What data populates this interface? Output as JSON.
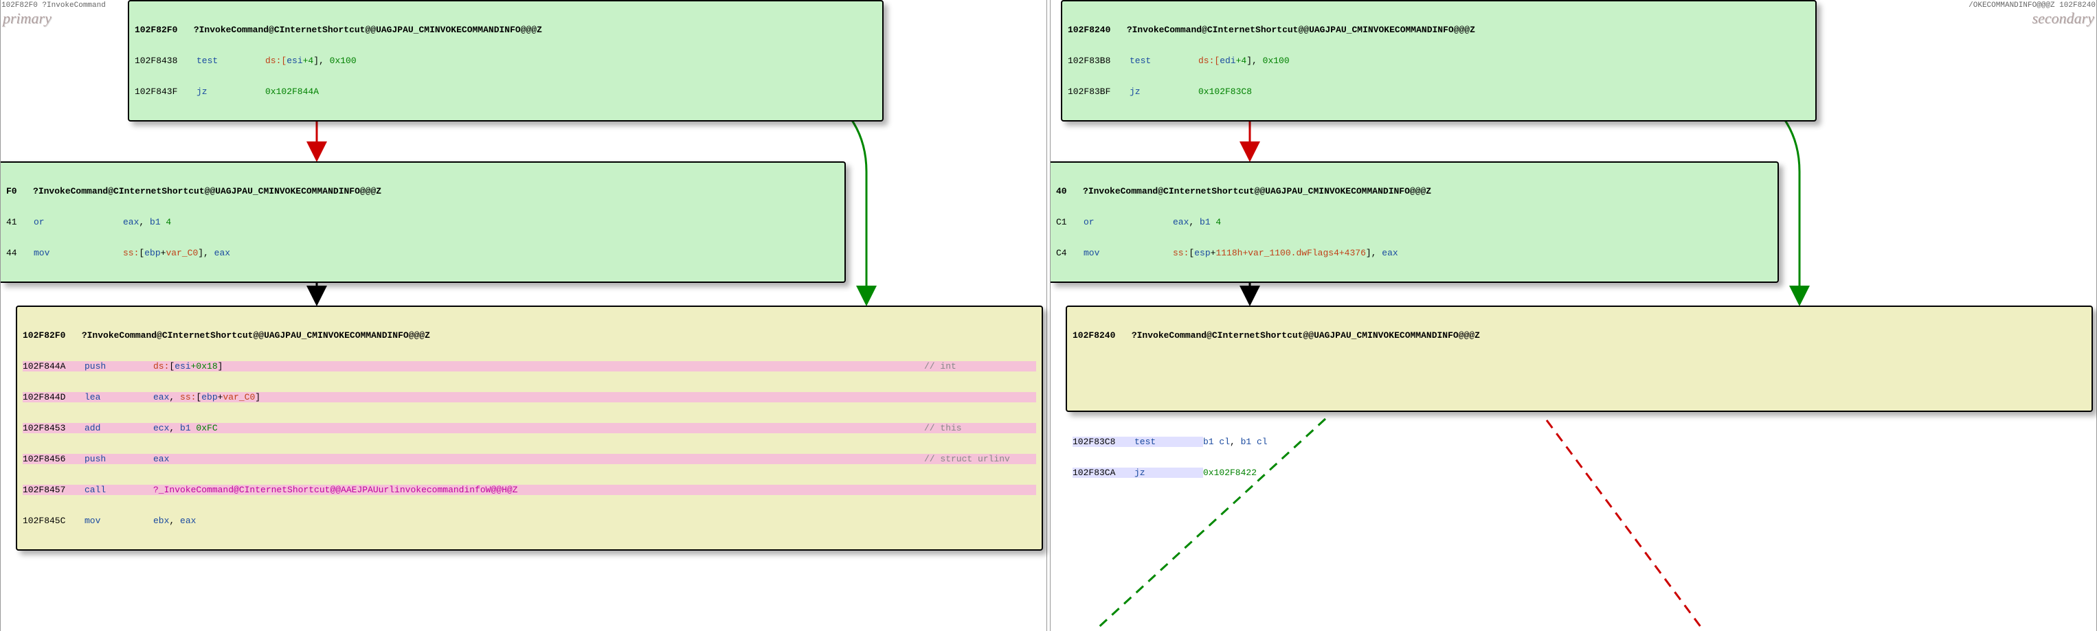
{
  "header": {
    "left_text": "102F82F0  ?InvokeCommand",
    "right_text": "/OKECOMMANDINFO@@@Z  102F8240",
    "primary_label": "primary",
    "secondary_label": "secondary"
  },
  "left": {
    "block1": {
      "addr": "102F82F0",
      "func": "?InvokeCommand@CInternetShortcut@@UAGJPAU_CMINVOKECOMMANDINFO@@@Z",
      "rows": [
        {
          "addr": "102F8438",
          "mnem": "test",
          "ops_pre": "ds:[",
          "ops_reg": "esi",
          "ops_off": "+4",
          "ops_post": "], ",
          "ops_val": "0x100"
        },
        {
          "addr": "102F843F",
          "mnem": "jz",
          "target": "0x102F844A"
        }
      ]
    },
    "block2": {
      "addr": "F0",
      "func": "?InvokeCommand@CInternetShortcut@@UAGJPAU_CMINVOKECOMMANDINFO@@@Z",
      "rows": [
        {
          "addr": "41",
          "mnem": "or",
          "op1": "eax",
          "sep": ", ",
          "b1": "b1 ",
          "val": "4"
        },
        {
          "addr": "44",
          "mnem": "mov",
          "seg": "ss:",
          "br": "[",
          "reg": "ebp",
          "plus": "+",
          "var": "var_C0",
          "cl": "], ",
          "reg2": "eax"
        }
      ]
    },
    "block3": {
      "addr": "102F82F0",
      "func": "?InvokeCommand@CInternetShortcut@@UAGJPAU_CMINVOKECOMMANDINFO@@@Z",
      "rows": [
        {
          "addr": "102F844A",
          "mnem": "push",
          "seg": "ds:",
          "br": "[",
          "reg": "esi",
          "off": "+0x18",
          "cl": "]",
          "comment": "// int"
        },
        {
          "addr": "102F844D",
          "mnem": "lea",
          "op1": "eax",
          "sep": ", ",
          "seg": "ss:",
          "br": "[",
          "reg": "ebp",
          "plus": "+",
          "var": "var_C0",
          "cl": "]"
        },
        {
          "addr": "102F8453",
          "mnem": "add",
          "op1": "ecx",
          "sep": ", ",
          "b1": "b1 ",
          "val": "0xFC",
          "comment": "// this"
        },
        {
          "addr": "102F8456",
          "mnem": "push",
          "op1": "eax",
          "comment": "// struct urlinv"
        },
        {
          "addr": "102F8457",
          "mnem": "call",
          "sym": "?_InvokeCommand@CInternetShortcut@@AAEJPAUurlinvokecommandinfoW@@H@Z"
        },
        {
          "addr": "102F845C",
          "mnem": "mov",
          "op1": "ebx",
          "sep": ", ",
          "op2": "eax"
        }
      ]
    }
  },
  "right": {
    "block1": {
      "addr": "102F8240",
      "func": "?InvokeCommand@CInternetShortcut@@UAGJPAU_CMINVOKECOMMANDINFO@@@Z",
      "rows": [
        {
          "addr": "102F83B8",
          "mnem": "test",
          "ops_pre": "ds:[",
          "ops_reg": "edi",
          "ops_off": "+4",
          "ops_post": "], ",
          "ops_val": "0x100"
        },
        {
          "addr": "102F83BF",
          "mnem": "jz",
          "target": "0x102F83C8"
        }
      ]
    },
    "block2": {
      "addr": "40",
      "func": "?InvokeCommand@CInternetShortcut@@UAGJPAU_CMINVOKECOMMANDINFO@@@Z",
      "rows": [
        {
          "addr": "C1",
          "mnem": "or",
          "op1": "eax",
          "sep": ", ",
          "b1": "b1 ",
          "val": "4"
        },
        {
          "addr": "C4",
          "mnem": "mov",
          "seg": "ss:",
          "br": "[",
          "reg": "esp",
          "plus": "+",
          "var": "1118h+var_1100.dwFlags4+4376",
          "cl": "], ",
          "reg2": "eax"
        }
      ]
    },
    "block3": {
      "addr": "102F8240",
      "func": "?InvokeCommand@CInternetShortcut@@UAGJPAU_CMINVOKECOMMANDINFO@@@Z",
      "rows": [
        {
          "addr": "102F83C8",
          "mnem": "test",
          "b1a": "b1 ",
          "r1": "cl",
          "sep": ", ",
          "b1b": "b1 ",
          "r2": "cl"
        },
        {
          "addr": "102F83CA",
          "mnem": "jz",
          "target": "0x102F8422"
        }
      ]
    }
  }
}
